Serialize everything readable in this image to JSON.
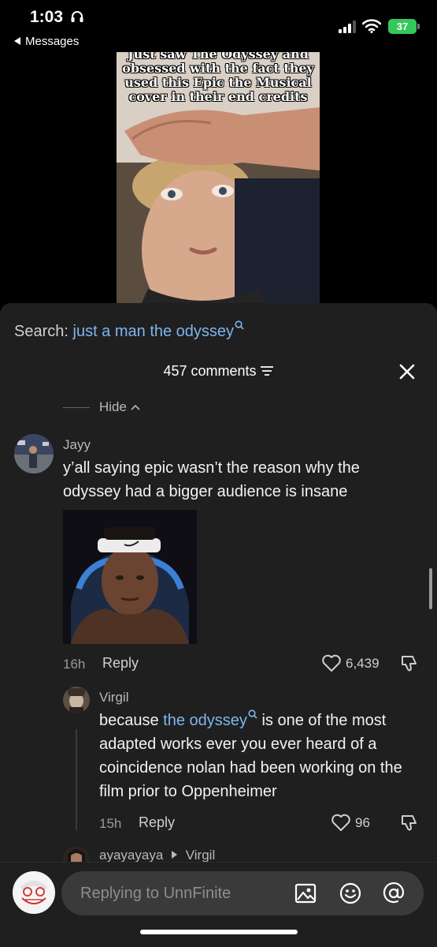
{
  "status_bar": {
    "time": "1:03",
    "back_label": "Messages",
    "battery": "37"
  },
  "video": {
    "caption": "Just saw The Odyssey and obsessed with the fact they used this Epic the Musical cover in their end credits"
  },
  "comments_sheet": {
    "search_label": "Search:",
    "search_query": "just a man the odyssey",
    "comment_count": "457 comments",
    "hide_label": "Hide",
    "comments": [
      {
        "username": "Jayy",
        "text": "y’all saying epic wasn’t the reason why the odyssey had a bigger audience is insane",
        "time": "16h",
        "reply_label": "Reply",
        "likes": "6,439"
      },
      {
        "username": "Virgil",
        "text_before": "because ",
        "text_link": "the odyssey",
        "text_after": " is one of the most adapted works ever you ever heard of a coincidence nolan had been working on the film prior to Oppenheimer",
        "time": "15h",
        "reply_label": "Reply",
        "likes": "96"
      },
      {
        "username": "ayayayaya",
        "reply_to": "Virgil"
      }
    ],
    "input_placeholder": "Replying to UnnFinite"
  },
  "colors": {
    "sheet_bg": "#1f1f1f",
    "link_blue": "#7db6f0",
    "battery_green": "#34c759"
  },
  "icons": [
    "headphones-icon",
    "signal-icon",
    "wifi-icon",
    "search-icon",
    "filter-icon",
    "close-icon",
    "chevron-up-icon",
    "heart-icon",
    "dislike-icon",
    "image-icon",
    "emoji-icon",
    "mention-icon"
  ]
}
